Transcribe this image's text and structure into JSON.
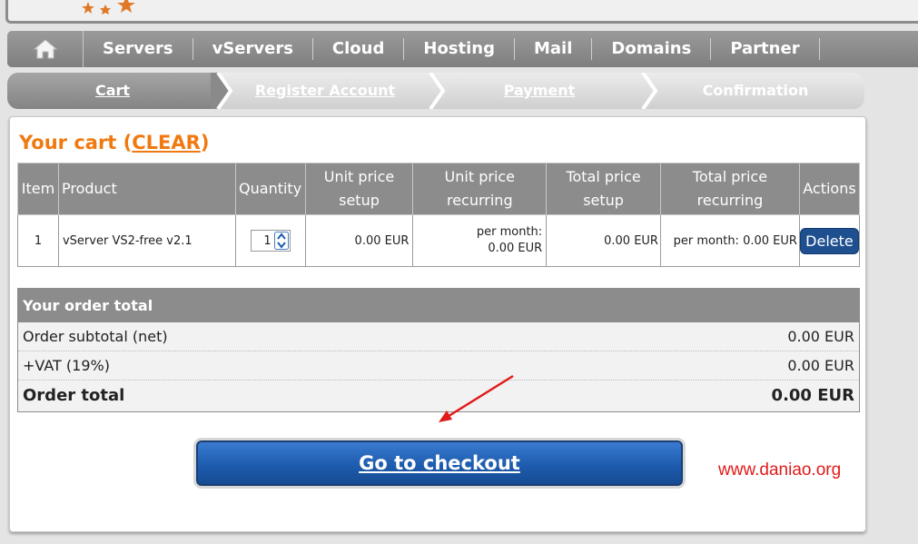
{
  "nav": {
    "items": [
      "Servers",
      "vServers",
      "Cloud",
      "Hosting",
      "Mail",
      "Domains",
      "Partner"
    ]
  },
  "steps": [
    "Cart",
    "Register Account",
    "Payment",
    "Confirmation"
  ],
  "cart": {
    "title": "Your cart",
    "clear_label": "CLEAR",
    "columns": {
      "item": "Item",
      "product": "Product",
      "quantity": "Quantity",
      "unit_setup_1": "Unit price",
      "unit_setup_2": "setup",
      "unit_recurring_1": "Unit price",
      "unit_recurring_2": "recurring",
      "total_setup_1": "Total price",
      "total_setup_2": "setup",
      "total_recurring_1": "Total price",
      "total_recurring_2": "recurring",
      "actions": "Actions"
    },
    "rows": [
      {
        "item": "1",
        "product": "vServer VS2-free v2.1",
        "quantity": "1",
        "unit_setup": "0.00 EUR",
        "unit_recurring_1": "per month:",
        "unit_recurring_2": "0.00 EUR",
        "total_setup": "0.00 EUR",
        "total_recurring": "per month: 0.00 EUR",
        "action": "Delete"
      }
    ]
  },
  "order": {
    "heading": "Your order total",
    "subtotal_label": "Order subtotal (net)",
    "subtotal_value": "0.00 EUR",
    "vat_label": "+VAT (19%)",
    "vat_value": "0.00 EUR",
    "total_label": "Order total",
    "total_value": "0.00 EUR"
  },
  "checkout_label": "Go to checkout",
  "watermark": "www.daniao.org",
  "colors": {
    "accent_orange": "#f07a10",
    "nav_gray": "#8c8c8c",
    "button_blue": "#1d5cae",
    "watermark_red": "#e21a1a"
  }
}
